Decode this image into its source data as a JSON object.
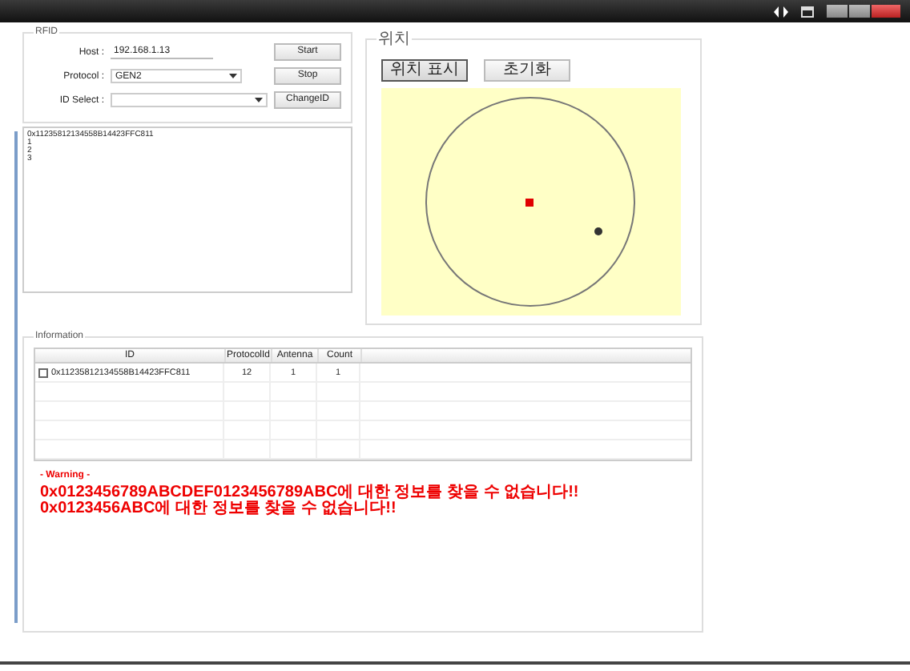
{
  "rfid": {
    "title": "RFID",
    "host_label": "Host :",
    "host": "192.168.1.13",
    "protocol_label": "Protocol :",
    "protocol": "GEN2",
    "id_select_label": "ID Select :",
    "buttons": [
      {
        "label": "Start"
      },
      {
        "label": "Stop"
      },
      {
        "label": "ChangeID"
      }
    ]
  },
  "log": {
    "lines": [
      "0x11235812134558B14423FFC811",
      "1",
      "2",
      "3"
    ]
  },
  "location": {
    "title": "위치",
    "buttons": [
      {
        "label": "위치 표시",
        "selected": true
      },
      {
        "label": "초기화",
        "selected": false
      }
    ]
  },
  "information": {
    "title": "Information",
    "table": {
      "columns": [
        "ID",
        "ProtocolId",
        "Antenna",
        "Count"
      ],
      "rows": [
        {
          "checked": false,
          "cells": [
            "0x11235812134558B14423FFC811",
            "12",
            "1",
            "1"
          ]
        }
      ]
    },
    "warning_title": "- Warning -",
    "warnings": [
      "0x0123456789ABCDEF0123456789ABC에 대한 정보를 찾을 수 없습니다!!",
      "0x0123456ABC에 대한 정보를 찾을 수 없습니다!!"
    ]
  }
}
